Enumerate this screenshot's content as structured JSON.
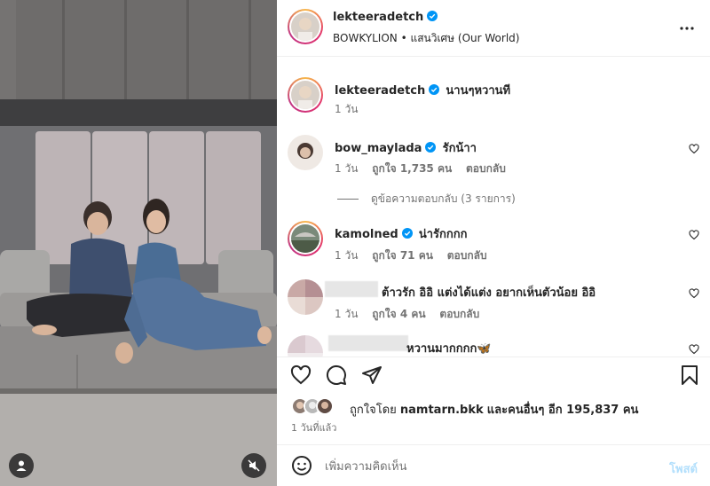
{
  "post": {
    "author": "lekteeradetch",
    "subtitle": "BOWKYLION • แสนวิเศษ (Our World)"
  },
  "caption": {
    "user": "lekteeradetch",
    "text": "นานๆหวานที",
    "time": "1 วัน"
  },
  "comments": [
    {
      "user": "bow_maylada",
      "verified": true,
      "text": "รักน้าา",
      "time": "1 วัน",
      "likes": "ถูกใจ 1,735 คน",
      "reply": "ตอบกลับ",
      "replies_label": "ดูข้อความตอบกลับ (3 รายการ)"
    },
    {
      "user": "kamolned",
      "verified": true,
      "text": "น่ารักกกก",
      "time": "1 วัน",
      "likes": "ถูกใจ 71 คน",
      "reply": "ตอบกลับ"
    },
    {
      "user": "",
      "verified": false,
      "text": "ต้าวรัก อิอิ แต่งได้แต่ง อยากเห็นตัวน้อย อิอิ",
      "time": "1 วัน",
      "likes": "ถูกใจ 4 คน",
      "reply": "ตอบกลับ"
    },
    {
      "user": "",
      "verified": false,
      "text": "หวานมากกกก🦋",
      "time": "",
      "likes": "",
      "reply": ""
    }
  ],
  "likes": {
    "prefix": "ถูกใจโดย",
    "user": "namtarn.bkk",
    "suffix": "และคนอื่นๆ อีก 195,837 คน"
  },
  "time_ago": "1 วันที่แล้ว",
  "add_comment": {
    "placeholder": "เพิ่มความคิดเห็น",
    "post_label": "โพสต์"
  },
  "colors": {
    "verified": "#0095f6",
    "post_button_disabled": "#b2dffc",
    "muted_text": "#737373"
  },
  "icons": [
    "heart-icon",
    "comment-icon",
    "share-icon",
    "bookmark-icon",
    "more-icon",
    "emoji-icon",
    "user-tag-icon",
    "mute-icon"
  ]
}
